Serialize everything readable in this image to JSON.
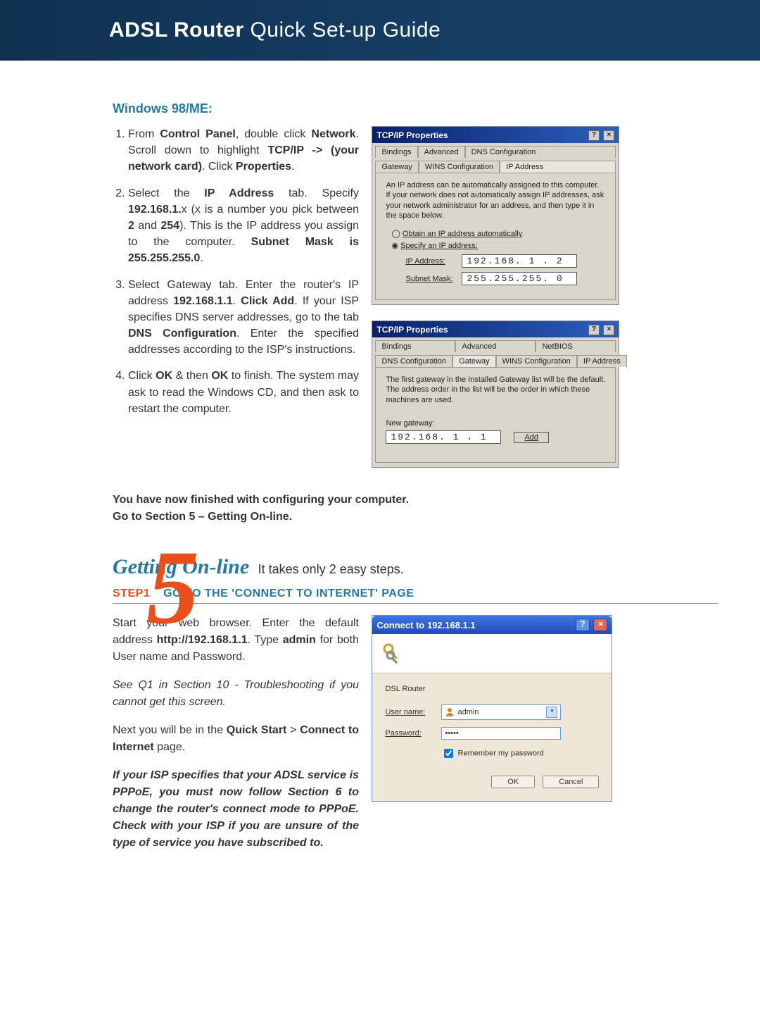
{
  "header": {
    "bold": "ADSL Router",
    "rest": " Quick Set-up Guide"
  },
  "win98": {
    "heading": "Windows 98/ME:",
    "steps": [
      {
        "pre": "From ",
        "b1": "Control Panel",
        "mid1": ", double click ",
        "b2": "Network",
        "mid2": ". Scroll down to highlight ",
        "b3": "TCP/IP -> (your network card)",
        "mid3": ". Click ",
        "b4": "Properties",
        "post": "."
      },
      {
        "pre": "Select the ",
        "b1": "IP Address",
        "mid1": " tab. Specify ",
        "b2": "192.168.1.",
        "mid2": "x (x is a number you pick between ",
        "b3": "2",
        "mid3": " and ",
        "b4": "254",
        "mid4": "). This is the IP address you assign to the computer. ",
        "b5": "Subnet Mask is 255.255.255.0",
        "post": "."
      },
      {
        "pre": "Select Gateway tab. Enter the router's IP address ",
        "b1": "192.168.1.1",
        "mid1": ". ",
        "b2": "Click Add",
        "mid2": ". If your ISP specifies DNS server addresses, go to the tab ",
        "b3": "DNS Configuration",
        "mid3": ". Enter the specified addresses according to the ISP's instructions.",
        "post": ""
      },
      {
        "pre": "Click ",
        "b1": "OK",
        "mid1": " & then ",
        "b2": "OK",
        "mid2": " to finish. The system may ask to read the Windows CD, and then ask to restart the computer.",
        "post": ""
      }
    ],
    "finish1": "You have now finished with configuring your computer.",
    "finish2": "Go to Section 5 – Getting On-line."
  },
  "dlg1": {
    "title": "TCP/IP Properties",
    "tabs_top": [
      "Bindings",
      "Advanced",
      "DNS Configuration"
    ],
    "tabs_bot": [
      "Gateway",
      "WINS Configuration",
      "IP Address"
    ],
    "desc": "An IP address can be automatically assigned to this computer. If your network does not automatically assign IP addresses, ask your network administrator for an address, and then type it in the space below.",
    "opt_auto": "Obtain an IP address automatically",
    "opt_spec": "Specify an IP address:",
    "ip_label": "IP Address:",
    "ip_value": "192.168. 1 .  2",
    "mask_label": "Subnet Mask:",
    "mask_value": "255.255.255. 0"
  },
  "dlg2": {
    "title": "TCP/IP Properties",
    "tabs_top": [
      "Bindings",
      "Advanced",
      "NetBIOS"
    ],
    "tabs_bot": [
      "DNS Configuration",
      "Gateway",
      "WINS Configuration",
      "IP Address"
    ],
    "desc": "The first gateway in the Installed Gateway list will be the default. The address order in the list will be the order in which these machines are used.",
    "newgw_label": "New gateway:",
    "newgw_value": "192.168. 1 . 1",
    "add_btn": "Add"
  },
  "sec5": {
    "numeral": "5",
    "title": "Getting On-line",
    "subtitle": "It takes only 2 easy steps.",
    "step_label": "STEP1",
    "step_title": "GO TO THE 'CONNECT TO INTERNET' PAGE",
    "p1a": "Start your web browser. Enter the default address ",
    "p1b": "http://192.168.1.1",
    "p1c": ". Type ",
    "p1d": "admin",
    "p1e": " for both User name and Password.",
    "p2": "See Q1 in Section 10 - Troubleshooting if you cannot get this screen.",
    "p3a": "Next you will be in the ",
    "p3b": "Quick Start",
    "p3c": " > ",
    "p3d": "Connect to Internet",
    "p3e": " page.",
    "p4": "If your ISP specifies that your ADSL service is PPPoE, you must now follow Section 6 to change the router's connect mode to PPPoE. Check with your ISP if you are unsure of the type of service you have subscribed to."
  },
  "xp": {
    "title": "Connect to 192.168.1.1",
    "server": "DSL Router",
    "user_label": "User name:",
    "user_value": "admin",
    "pass_label": "Password:",
    "pass_value": "•••••",
    "remember": "Remember my password",
    "ok": "OK",
    "cancel": "Cancel"
  }
}
